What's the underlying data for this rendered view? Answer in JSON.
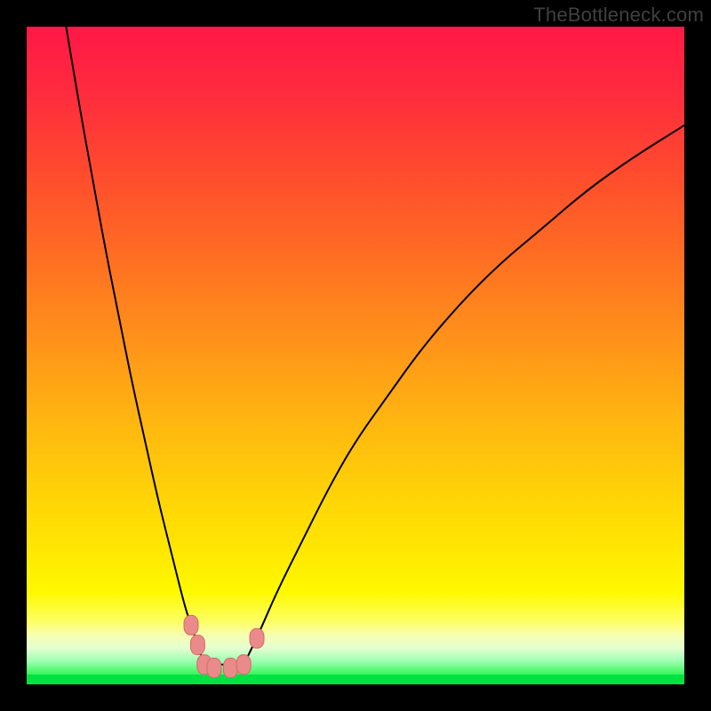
{
  "watermark": "TheBottleneck.com",
  "colors": {
    "bg": "#000000",
    "curve": "#000000",
    "marker_fill": "#ea8a8a",
    "marker_stroke": "#d46b6b",
    "green_band": "#00e243",
    "gradient_stops": [
      {
        "offset": 0.0,
        "color": "#ff1846"
      },
      {
        "offset": 0.1,
        "color": "#ff2b3e"
      },
      {
        "offset": 0.22,
        "color": "#ff4a2e"
      },
      {
        "offset": 0.35,
        "color": "#ff6e22"
      },
      {
        "offset": 0.48,
        "color": "#ff931a"
      },
      {
        "offset": 0.6,
        "color": "#ffb610"
      },
      {
        "offset": 0.72,
        "color": "#ffd507"
      },
      {
        "offset": 0.8,
        "color": "#ffe802"
      },
      {
        "offset": 0.86,
        "color": "#fff900"
      },
      {
        "offset": 0.905,
        "color": "#fdff66"
      },
      {
        "offset": 0.925,
        "color": "#f6ffb0"
      },
      {
        "offset": 0.945,
        "color": "#e4ffd0"
      },
      {
        "offset": 0.965,
        "color": "#9dffb0"
      },
      {
        "offset": 0.985,
        "color": "#34f659"
      },
      {
        "offset": 1.0,
        "color": "#00e243"
      }
    ]
  },
  "chart_data": {
    "type": "line",
    "title": "",
    "xlabel": "",
    "ylabel": "",
    "x_range": [
      0,
      100
    ],
    "y_range": [
      0,
      100
    ],
    "series": [
      {
        "name": "left-curve",
        "x": [
          6,
          8,
          10,
          12,
          14,
          16,
          18,
          20,
          22,
          24,
          25,
          26,
          27
        ],
        "y": [
          100,
          88,
          77,
          66,
          56,
          46,
          37,
          28,
          20,
          12,
          9,
          6,
          3
        ]
      },
      {
        "name": "right-curve",
        "x": [
          33,
          35,
          38,
          42,
          46,
          50,
          55,
          60,
          66,
          72,
          78,
          85,
          92,
          100
        ],
        "y": [
          3,
          7,
          14,
          22,
          30,
          37,
          44,
          51,
          58,
          64,
          69,
          75,
          80,
          85
        ]
      }
    ],
    "valley_floor": {
      "x": [
        27,
        33
      ],
      "y": [
        3,
        3
      ]
    },
    "markers": [
      {
        "series": "left-curve",
        "x": 25,
        "y": 9
      },
      {
        "series": "left-curve",
        "x": 26,
        "y": 6
      },
      {
        "series": "left-curve",
        "x": 27,
        "y": 3
      },
      {
        "series": "valley",
        "x": 28.5,
        "y": 2.5
      },
      {
        "series": "valley",
        "x": 31,
        "y": 2.5
      },
      {
        "series": "right-curve",
        "x": 33,
        "y": 3
      },
      {
        "series": "right-curve",
        "x": 35,
        "y": 7
      }
    ]
  }
}
